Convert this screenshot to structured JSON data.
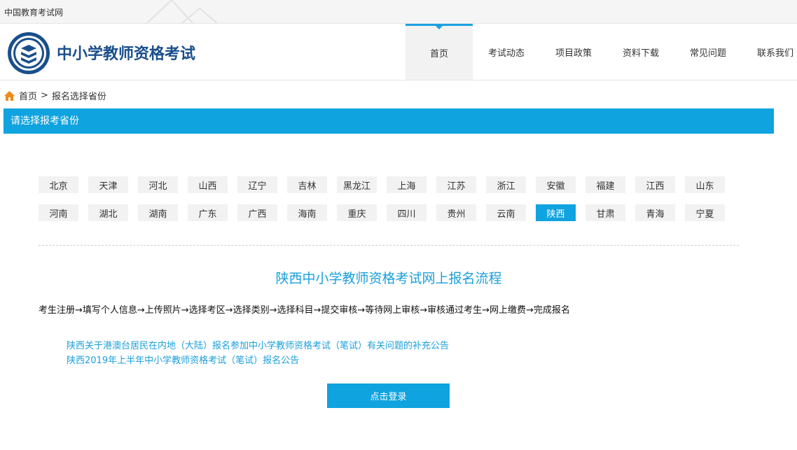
{
  "topbar": {
    "site_name": "中国教育考试网"
  },
  "header": {
    "brand": "中小学教师资格考试",
    "nav": [
      {
        "label": "首页",
        "active": true
      },
      {
        "label": "考试动态",
        "active": false
      },
      {
        "label": "项目政策",
        "active": false
      },
      {
        "label": "资料下载",
        "active": false
      },
      {
        "label": "常见问题",
        "active": false
      },
      {
        "label": "联系我们",
        "active": false
      }
    ]
  },
  "breadcrumb": {
    "home": "首页",
    "separator": ">",
    "current": "报名选择省份"
  },
  "select_bar": {
    "title": "请选择报考省份"
  },
  "provinces": {
    "row1": [
      "北京",
      "天津",
      "河北",
      "山西",
      "辽宁",
      "吉林",
      "黑龙江",
      "上海",
      "江苏",
      "浙江",
      "安徽",
      "福建",
      "江西",
      "山东"
    ],
    "row2": [
      "河南",
      "湖北",
      "湖南",
      "广东",
      "广西",
      "海南",
      "重庆",
      "四川",
      "贵州",
      "云南",
      "陕西",
      "甘肃",
      "青海",
      "宁夏"
    ],
    "selected": "陕西"
  },
  "flow": {
    "title": "陕西中小学教师资格考试网上报名流程",
    "steps": "考生注册→填写个人信息→上传照片→选择考区→选择类别→选择科目→提交审核→等待网上审核→审核通过考生→网上缴费→完成报名"
  },
  "notices": [
    "陕西关于港澳台居民在内地（大陆）报名参加中小学教师资格考试（笔试）有关问题的补充公告",
    "陕西2019年上半年中小学教师资格考试（笔试）报名公告"
  ],
  "login_button": "点击登录",
  "colors": {
    "accent": "#0fa3df",
    "brand": "#1a4f8b",
    "link": "#1a9fdb"
  }
}
